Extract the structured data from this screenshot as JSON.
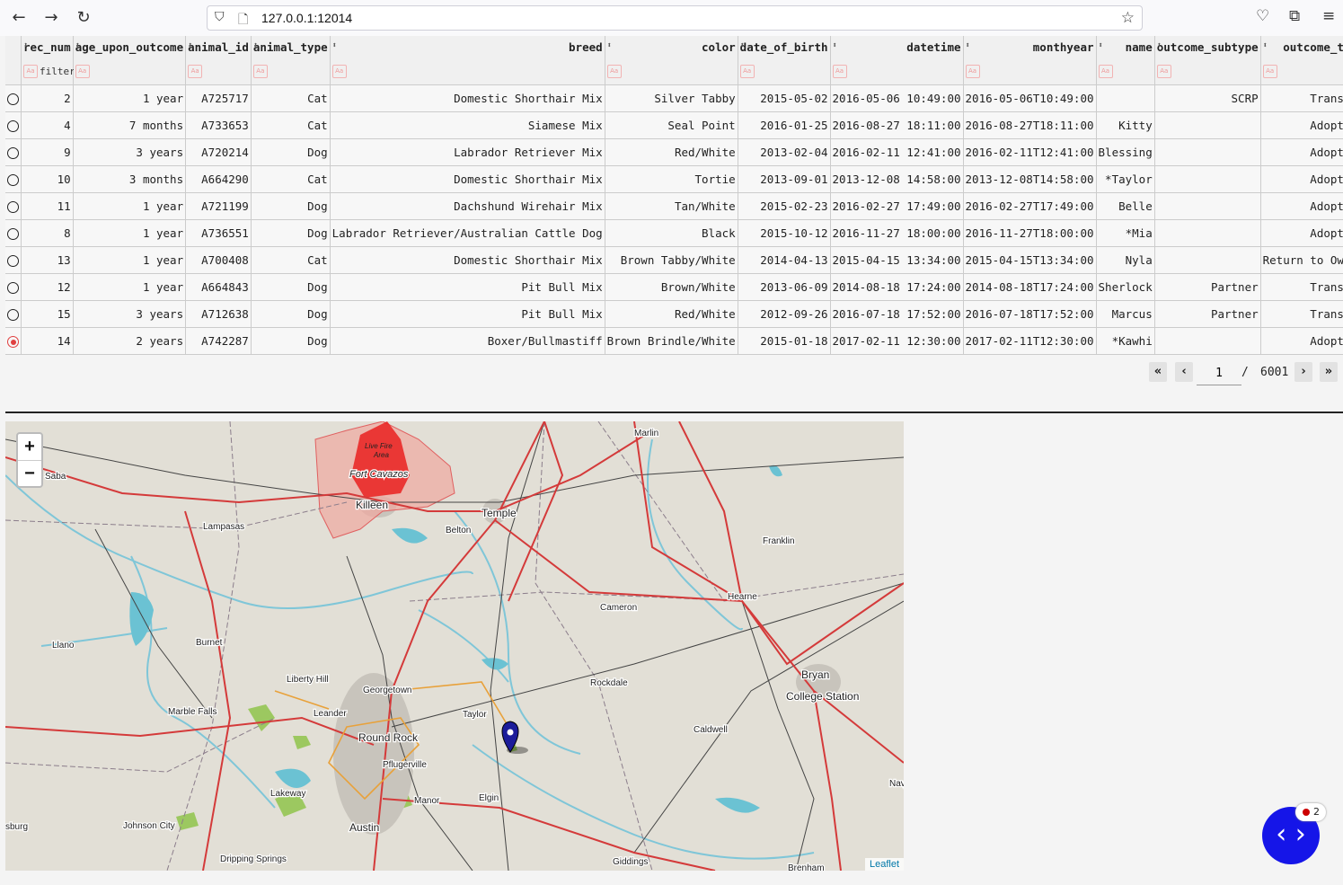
{
  "browser": {
    "url": "127.0.0.1:12014",
    "back_icon": "←",
    "forward_icon": "→",
    "reload_icon": "↻"
  },
  "table": {
    "columns": [
      "",
      "rec_num",
      "age_upon_outcome",
      "animal_id",
      "animal_type",
      "breed",
      "color",
      "date_of_birth",
      "datetime",
      "monthyear",
      "name",
      "outcome_subtype",
      "outcome_t"
    ],
    "filter_placeholder": "filter",
    "rows": [
      {
        "selected": false,
        "cells": [
          "2",
          "1 year",
          "A725717",
          "Cat",
          "Domestic Shorthair Mix",
          "Silver Tabby",
          "2015-05-02",
          "2016-05-06 10:49:00",
          "2016-05-06T10:49:00",
          "",
          "SCRP",
          "Trans"
        ]
      },
      {
        "selected": false,
        "cells": [
          "4",
          "7 months",
          "A733653",
          "Cat",
          "Siamese Mix",
          "Seal Point",
          "2016-01-25",
          "2016-08-27 18:11:00",
          "2016-08-27T18:11:00",
          "Kitty",
          "",
          "Adopt"
        ]
      },
      {
        "selected": false,
        "cells": [
          "9",
          "3 years",
          "A720214",
          "Dog",
          "Labrador Retriever Mix",
          "Red/White",
          "2013-02-04",
          "2016-02-11 12:41:00",
          "2016-02-11T12:41:00",
          "Blessing",
          "",
          "Adopt"
        ]
      },
      {
        "selected": false,
        "cells": [
          "10",
          "3 months",
          "A664290",
          "Cat",
          "Domestic Shorthair Mix",
          "Tortie",
          "2013-09-01",
          "2013-12-08 14:58:00",
          "2013-12-08T14:58:00",
          "*Taylor",
          "",
          "Adopt"
        ]
      },
      {
        "selected": false,
        "cells": [
          "11",
          "1 year",
          "A721199",
          "Dog",
          "Dachshund Wirehair Mix",
          "Tan/White",
          "2015-02-23",
          "2016-02-27 17:49:00",
          "2016-02-27T17:49:00",
          "Belle",
          "",
          "Adopt"
        ]
      },
      {
        "selected": false,
        "cells": [
          "8",
          "1 year",
          "A736551",
          "Dog",
          "Labrador Retriever/Australian Cattle Dog",
          "Black",
          "2015-10-12",
          "2016-11-27 18:00:00",
          "2016-11-27T18:00:00",
          "*Mia",
          "",
          "Adopt"
        ]
      },
      {
        "selected": false,
        "cells": [
          "13",
          "1 year",
          "A700408",
          "Cat",
          "Domestic Shorthair Mix",
          "Brown Tabby/White",
          "2014-04-13",
          "2015-04-15 13:34:00",
          "2015-04-15T13:34:00",
          "Nyla",
          "",
          "Return to Ow"
        ]
      },
      {
        "selected": false,
        "cells": [
          "12",
          "1 year",
          "A664843",
          "Dog",
          "Pit Bull Mix",
          "Brown/White",
          "2013-06-09",
          "2014-08-18 17:24:00",
          "2014-08-18T17:24:00",
          "Sherlock",
          "Partner",
          "Trans"
        ]
      },
      {
        "selected": false,
        "cells": [
          "15",
          "3 years",
          "A712638",
          "Dog",
          "Pit Bull Mix",
          "Red/White",
          "2012-09-26",
          "2016-07-18 17:52:00",
          "2016-07-18T17:52:00",
          "Marcus",
          "Partner",
          "Trans"
        ]
      },
      {
        "selected": true,
        "cells": [
          "14",
          "2 years",
          "A742287",
          "Dog",
          "Boxer/Bullmastiff",
          "Brown Brindle/White",
          "2015-01-18",
          "2017-02-11 12:30:00",
          "2017-02-11T12:30:00",
          "*Kawhi",
          "",
          "Adopt"
        ]
      }
    ]
  },
  "pager": {
    "first": "«",
    "prev": "‹",
    "page": "1",
    "separator": "/",
    "total": "6001",
    "next": "›",
    "last": "»"
  },
  "map": {
    "zoom_in": "+",
    "zoom_out": "−",
    "attribution": "Leaflet",
    "fire_area_label_1": "Live Fire",
    "fire_area_label_2": "Area",
    "places": [
      "Marlin",
      "Saba",
      "Fort Cavazos",
      "Killeen",
      "Temple",
      "Belton",
      "Lampasas",
      "Franklin",
      "Hearne",
      "Cameron",
      "Llano",
      "Burnet",
      "Liberty Hill",
      "Georgetown",
      "Rockdale",
      "Bryan",
      "College Station",
      "Marble Falls",
      "Leander",
      "Taylor",
      "Caldwell",
      "Round Rock",
      "Pflugerville",
      "Lakeway",
      "Manor",
      "Elgin",
      "Nav",
      "sburg",
      "Johnson City",
      "Austin",
      "Dripping Springs",
      "Giddings",
      "Brenham"
    ]
  },
  "fab": {
    "icon": "‹ ›",
    "badge_count": "2"
  }
}
